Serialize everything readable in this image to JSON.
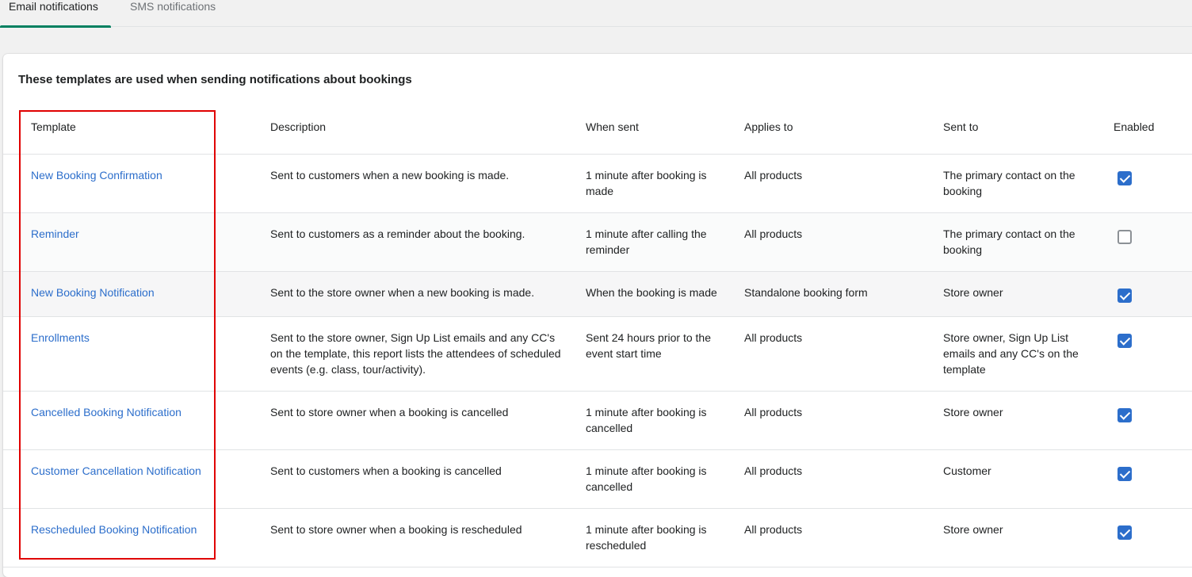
{
  "tabs": [
    {
      "label": "Email notifications",
      "active": true
    },
    {
      "label": "SMS notifications",
      "active": false
    }
  ],
  "card": {
    "heading": "These templates are used when sending notifications about bookings"
  },
  "table": {
    "headers": {
      "template": "Template",
      "description": "Description",
      "when_sent": "When sent",
      "applies_to": "Applies to",
      "sent_to": "Sent to",
      "enabled": "Enabled"
    },
    "rows": [
      {
        "template": "New Booking Confirmation",
        "description": "Sent to customers when a new booking is made.",
        "when_sent": "1 minute after booking is made",
        "applies_to": "All products",
        "sent_to": "The primary contact on the booking",
        "enabled": true
      },
      {
        "template": "Reminder",
        "description": "Sent to customers as a reminder about the booking.",
        "when_sent": "1 minute after calling the reminder",
        "applies_to": "All products",
        "sent_to": "The primary contact on the booking",
        "enabled": false
      },
      {
        "template": "New Booking Notification",
        "description": "Sent to the store owner when a new booking is made.",
        "when_sent": "When the booking is made",
        "applies_to": "Standalone booking form",
        "sent_to": "Store owner",
        "enabled": true
      },
      {
        "template": "Enrollments",
        "description": "Sent to the store owner, Sign Up List emails and any CC's on the template, this report lists the attendees of scheduled events (e.g. class, tour/activity).",
        "when_sent": "Sent 24 hours prior to the event start time",
        "applies_to": "All products",
        "sent_to": "Store owner, Sign Up List emails and any CC's on the template",
        "enabled": true
      },
      {
        "template": "Cancelled Booking Notification",
        "description": "Sent to store owner when a booking is cancelled",
        "when_sent": "1 minute after booking is cancelled",
        "applies_to": "All products",
        "sent_to": "Store owner",
        "enabled": true
      },
      {
        "template": "Customer Cancellation Notification",
        "description": "Sent to customers when a booking is cancelled",
        "when_sent": "1 minute after booking is cancelled",
        "applies_to": "All products",
        "sent_to": "Customer",
        "enabled": true
      },
      {
        "template": "Rescheduled Booking Notification",
        "description": "Sent to store owner when a booking is rescheduled",
        "when_sent": "1 minute after booking is rescheduled",
        "applies_to": "All products",
        "sent_to": "Store owner",
        "enabled": true
      }
    ]
  },
  "colors": {
    "link": "#2c6ecb",
    "checkbox_on": "#2c6ecb",
    "active_tab_underline": "#008060",
    "highlight_annotation": "#e00000"
  },
  "icons": {
    "checked": "checkbox-checked-icon",
    "unchecked": "checkbox-unchecked-icon"
  }
}
